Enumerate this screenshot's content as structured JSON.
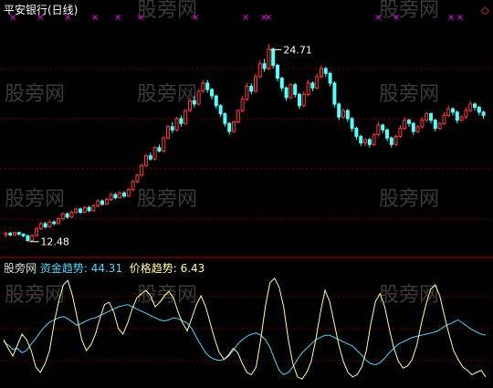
{
  "chart_data": [
    {
      "type": "candlestick",
      "title": "平安银行(日线)",
      "price_range": [
        11.9,
        26.2
      ],
      "annotations": {
        "high_label": "24.71",
        "low_label": "12.48"
      },
      "colors": {
        "up": "#ff3c3c",
        "down": "#54ffff",
        "title": "#ffffff",
        "marker": "#ff00ff",
        "corner": "#ff3c3c"
      },
      "candles": [
        [
          12.9,
          13.0,
          12.75,
          13.1
        ],
        [
          13.0,
          12.9,
          12.8,
          13.1
        ],
        [
          12.9,
          13.05,
          12.85,
          13.1
        ],
        [
          13.05,
          12.95,
          12.85,
          13.1
        ],
        [
          12.95,
          12.85,
          12.75,
          13.0
        ],
        [
          12.85,
          12.55,
          12.48,
          12.9
        ],
        [
          12.55,
          12.85,
          12.5,
          12.95
        ],
        [
          12.85,
          13.3,
          12.8,
          13.4
        ],
        [
          13.3,
          13.6,
          13.2,
          13.7
        ],
        [
          13.6,
          13.4,
          13.3,
          13.7
        ],
        [
          13.4,
          13.7,
          13.35,
          13.8
        ],
        [
          13.7,
          13.6,
          13.5,
          13.8
        ],
        [
          13.6,
          13.9,
          13.55,
          14.0
        ],
        [
          13.9,
          14.2,
          13.8,
          14.3
        ],
        [
          14.2,
          14.0,
          13.9,
          14.3
        ],
        [
          14.0,
          14.3,
          13.95,
          14.4
        ],
        [
          14.3,
          14.5,
          14.2,
          14.6
        ],
        [
          14.5,
          14.3,
          14.2,
          14.6
        ],
        [
          14.3,
          14.6,
          14.25,
          14.7
        ],
        [
          14.6,
          14.4,
          14.3,
          14.7
        ],
        [
          14.4,
          14.7,
          14.35,
          14.8
        ],
        [
          14.7,
          15.0,
          14.6,
          15.1
        ],
        [
          15.0,
          14.8,
          14.7,
          15.1
        ],
        [
          14.8,
          15.1,
          14.75,
          15.2
        ],
        [
          15.1,
          15.4,
          15.0,
          15.5
        ],
        [
          15.4,
          15.2,
          15.1,
          15.5
        ],
        [
          15.2,
          15.5,
          15.15,
          15.6
        ],
        [
          15.5,
          15.3,
          15.2,
          15.6
        ],
        [
          15.3,
          15.7,
          15.25,
          15.8
        ],
        [
          15.7,
          16.2,
          15.6,
          16.3
        ],
        [
          16.2,
          16.6,
          16.1,
          16.7
        ],
        [
          16.6,
          17.2,
          16.5,
          17.3
        ],
        [
          17.2,
          17.8,
          17.1,
          17.9
        ],
        [
          17.8,
          17.6,
          17.5,
          18.0
        ],
        [
          17.6,
          18.3,
          17.5,
          18.4
        ],
        [
          18.3,
          18.1,
          18.0,
          18.5
        ],
        [
          18.1,
          18.9,
          18.0,
          19.0
        ],
        [
          18.9,
          19.6,
          18.8,
          19.7
        ],
        [
          19.6,
          19.4,
          19.2,
          19.9
        ],
        [
          19.4,
          20.1,
          19.3,
          20.2
        ],
        [
          20.1,
          19.8,
          19.6,
          20.3
        ],
        [
          19.8,
          20.6,
          19.7,
          20.7
        ],
        [
          20.6,
          21.2,
          20.5,
          21.4
        ],
        [
          21.2,
          21.0,
          20.8,
          21.5
        ],
        [
          21.0,
          21.8,
          20.9,
          21.9
        ],
        [
          21.8,
          22.3,
          21.7,
          22.5
        ],
        [
          22.3,
          21.9,
          21.7,
          22.5
        ],
        [
          21.9,
          21.5,
          21.3,
          22.0
        ],
        [
          21.5,
          20.9,
          20.7,
          21.6
        ],
        [
          20.9,
          20.4,
          20.2,
          21.0
        ],
        [
          20.4,
          19.8,
          19.6,
          20.5
        ],
        [
          19.8,
          19.3,
          19.1,
          19.9
        ],
        [
          19.3,
          19.9,
          19.2,
          20.0
        ],
        [
          19.9,
          20.6,
          19.8,
          20.7
        ],
        [
          20.6,
          21.3,
          20.5,
          21.5
        ],
        [
          21.3,
          22.1,
          21.2,
          22.3
        ],
        [
          22.1,
          21.8,
          21.6,
          22.3
        ],
        [
          21.8,
          22.7,
          21.7,
          22.9
        ],
        [
          22.7,
          23.5,
          22.6,
          23.7
        ],
        [
          23.5,
          23.2,
          23.0,
          23.8
        ],
        [
          23.2,
          24.4,
          23.1,
          24.71
        ],
        [
          24.4,
          23.4,
          23.2,
          24.5
        ],
        [
          23.4,
          22.6,
          22.4,
          23.5
        ],
        [
          22.6,
          22.0,
          21.8,
          22.7
        ],
        [
          22.0,
          21.4,
          21.2,
          22.1
        ],
        [
          21.4,
          22.2,
          21.3,
          22.3
        ],
        [
          22.2,
          21.6,
          21.4,
          22.3
        ],
        [
          21.6,
          20.9,
          20.7,
          21.7
        ],
        [
          20.9,
          21.6,
          20.8,
          21.8
        ],
        [
          21.6,
          22.3,
          21.5,
          22.5
        ],
        [
          22.3,
          22.0,
          21.8,
          22.4
        ],
        [
          22.0,
          22.7,
          21.9,
          22.9
        ],
        [
          22.7,
          23.2,
          22.6,
          23.4
        ],
        [
          23.2,
          22.9,
          22.7,
          23.3
        ],
        [
          22.9,
          22.3,
          22.1,
          23.0
        ],
        [
          22.3,
          21.0,
          20.8,
          22.4
        ],
        [
          21.0,
          20.2,
          20.0,
          21.1
        ],
        [
          20.2,
          20.6,
          20.1,
          20.7
        ],
        [
          20.6,
          20.1,
          19.9,
          20.7
        ],
        [
          20.1,
          19.5,
          19.3,
          20.2
        ],
        [
          19.5,
          19.0,
          18.8,
          19.6
        ],
        [
          19.0,
          18.6,
          18.4,
          19.1
        ],
        [
          18.6,
          18.8,
          18.4,
          18.9
        ],
        [
          18.8,
          18.5,
          18.3,
          18.9
        ],
        [
          18.5,
          19.1,
          18.4,
          19.2
        ],
        [
          19.1,
          19.7,
          19.0,
          19.9
        ],
        [
          19.7,
          19.4,
          19.2,
          19.8
        ],
        [
          19.4,
          18.9,
          18.7,
          19.5
        ],
        [
          18.9,
          18.5,
          18.3,
          19.0
        ],
        [
          18.5,
          19.0,
          18.4,
          19.1
        ],
        [
          19.0,
          19.5,
          18.9,
          19.7
        ],
        [
          19.5,
          20.0,
          19.4,
          20.2
        ],
        [
          20.0,
          19.8,
          19.6,
          20.1
        ],
        [
          19.8,
          19.3,
          19.1,
          19.9
        ],
        [
          19.3,
          19.6,
          19.2,
          19.7
        ],
        [
          19.6,
          20.0,
          19.5,
          20.2
        ],
        [
          20.0,
          20.4,
          19.9,
          20.5
        ],
        [
          20.4,
          20.0,
          19.8,
          20.5
        ],
        [
          20.0,
          19.5,
          19.3,
          20.1
        ],
        [
          19.5,
          19.8,
          19.4,
          19.9
        ],
        [
          19.8,
          20.3,
          19.7,
          20.5
        ],
        [
          20.3,
          20.7,
          20.2,
          20.9
        ],
        [
          20.7,
          20.5,
          20.3,
          20.8
        ],
        [
          20.5,
          20.0,
          19.8,
          20.6
        ],
        [
          20.0,
          20.2,
          19.9,
          20.3
        ],
        [
          20.2,
          20.6,
          20.1,
          20.8
        ],
        [
          20.6,
          21.0,
          20.5,
          21.2
        ],
        [
          21.0,
          20.8,
          20.6,
          21.1
        ],
        [
          20.8,
          20.5,
          20.3,
          20.9
        ],
        [
          20.5,
          20.3,
          20.1,
          20.6
        ]
      ]
    },
    {
      "type": "line",
      "label_prefix": "股旁网",
      "y_range": [
        0,
        100
      ],
      "series": [
        {
          "name": "资金趋势",
          "value_label": "44.31",
          "color": "#4fd8ff",
          "values": [
            38,
            35,
            31,
            32,
            28,
            30,
            36,
            41,
            47,
            52,
            56,
            58,
            60,
            61,
            59,
            56,
            53,
            55,
            57,
            59,
            60,
            62,
            64,
            66,
            68,
            70,
            71,
            72,
            70,
            68,
            66,
            64,
            62,
            60,
            58,
            57,
            58,
            60,
            59,
            57,
            55,
            50,
            42,
            35,
            28,
            24,
            22,
            21,
            22,
            25,
            30,
            36,
            40,
            43,
            45,
            46,
            44,
            40,
            33,
            22,
            12,
            8,
            10,
            15,
            22,
            28,
            32,
            36,
            40,
            42,
            44,
            44,
            42,
            40,
            38,
            36,
            34,
            30,
            26,
            21,
            18,
            17,
            19,
            23,
            28,
            32,
            36,
            38,
            40,
            42,
            43,
            44,
            45,
            46,
            47,
            49,
            52,
            54,
            56,
            58,
            55,
            52,
            49,
            47,
            45,
            44
          ]
        },
        {
          "name": "价格趋势",
          "value_label": "6.43",
          "color": "#ffffa0",
          "values": [
            40,
            32,
            25,
            35,
            45,
            40,
            30,
            15,
            10,
            18,
            30,
            55,
            75,
            90,
            94,
            80,
            60,
            40,
            30,
            35,
            45,
            60,
            72,
            74,
            65,
            50,
            45,
            55,
            68,
            78,
            82,
            85,
            80,
            70,
            74,
            80,
            84,
            78,
            65,
            55,
            48,
            60,
            72,
            80,
            70,
            55,
            40,
            28,
            22,
            26,
            32,
            28,
            18,
            10,
            8,
            15,
            40,
            70,
            92,
            96,
            88,
            70,
            40,
            18,
            6,
            4,
            10,
            20,
            40,
            65,
            85,
            75,
            55,
            35,
            20,
            10,
            6,
            8,
            15,
            30,
            55,
            75,
            82,
            70,
            50,
            32,
            20,
            14,
            16,
            22,
            35,
            55,
            72,
            86,
            90,
            80,
            62,
            45,
            30,
            22,
            15,
            12,
            8,
            10,
            12,
            6
          ]
        }
      ]
    }
  ],
  "watermark": "股旁网"
}
